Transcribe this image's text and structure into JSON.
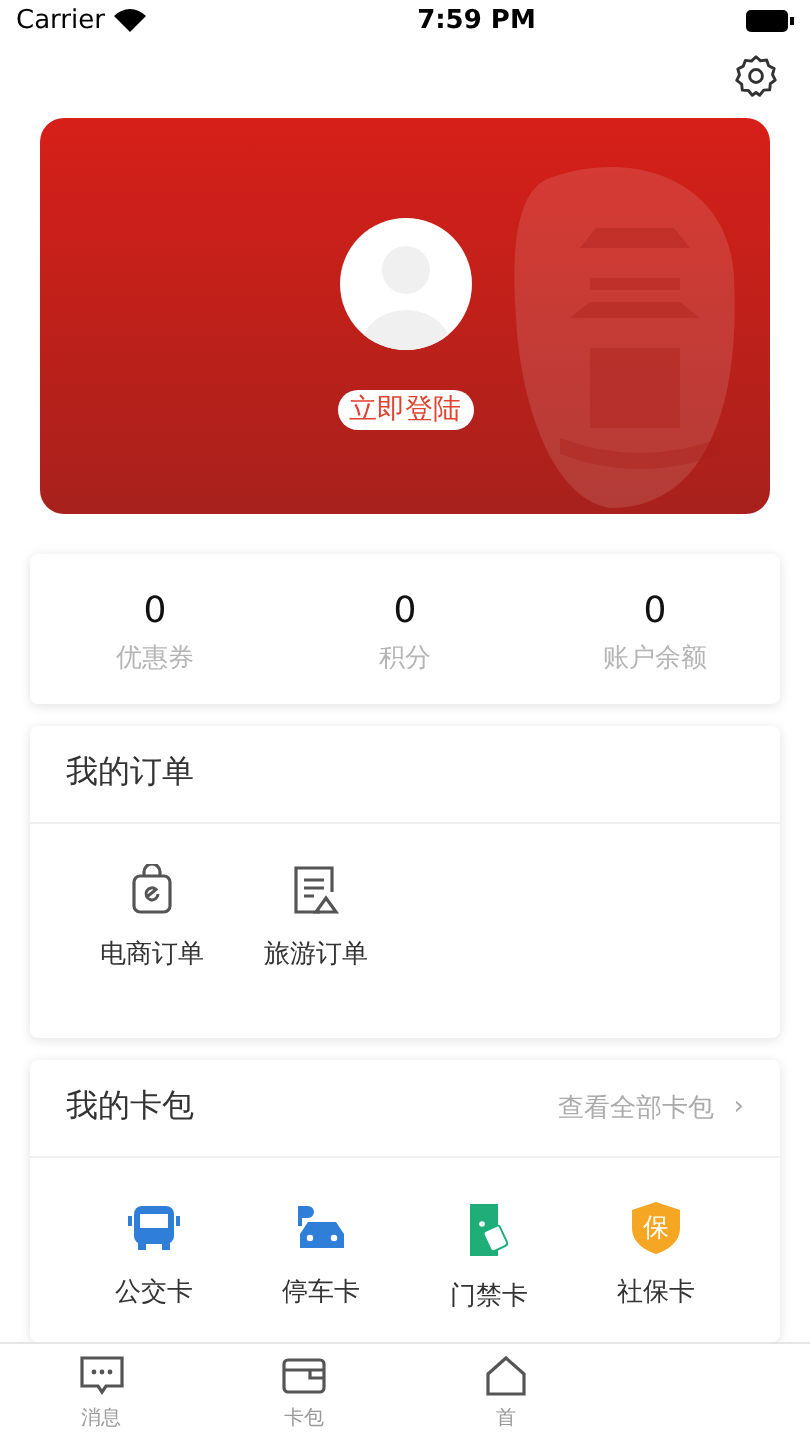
{
  "status_bar": {
    "carrier": "Carrier",
    "time": "7:59 PM"
  },
  "profile": {
    "login_button": "立即登陆"
  },
  "stats": [
    {
      "value": "0",
      "label": "优惠券"
    },
    {
      "value": "0",
      "label": "积分"
    },
    {
      "value": "0",
      "label": "账户余额"
    }
  ],
  "orders": {
    "title": "我的订单",
    "items": [
      {
        "kind": "shop",
        "label": "电商订单"
      },
      {
        "kind": "travel",
        "label": "旅游订单"
      }
    ]
  },
  "cards": {
    "title": "我的卡包",
    "link": "查看全部卡包",
    "link_arrow": "›",
    "items": [
      {
        "kind": "bus",
        "label": "公交卡"
      },
      {
        "kind": "parking",
        "label": "停车卡"
      },
      {
        "kind": "access",
        "label": "门禁卡"
      },
      {
        "kind": "social",
        "label": "社保卡",
        "badge_text": "保"
      }
    ]
  },
  "tab_bar": [
    {
      "kind": "message",
      "label": "消息"
    },
    {
      "kind": "wallet",
      "label": "卡包"
    },
    {
      "kind": "home",
      "label": "首"
    }
  ]
}
